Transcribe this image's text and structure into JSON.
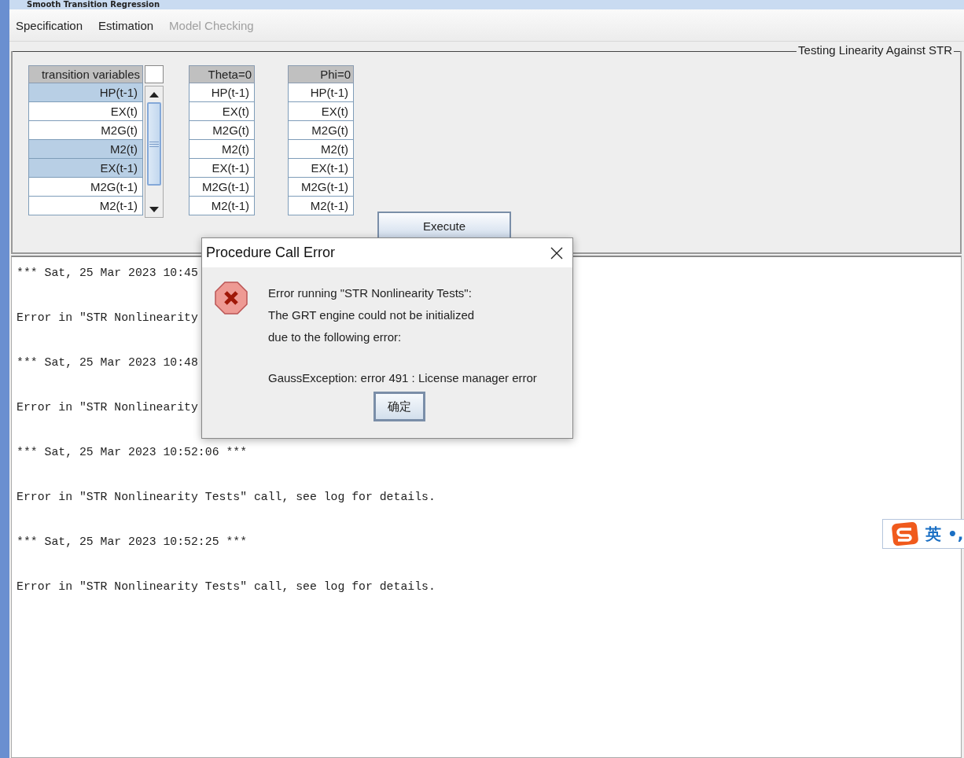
{
  "window": {
    "title": "Smooth Transition Regression"
  },
  "menu": [
    {
      "label": "Specification",
      "disabled": false
    },
    {
      "label": "Estimation",
      "disabled": false
    },
    {
      "label": "Model Checking",
      "disabled": true
    }
  ],
  "panel": {
    "title": "Testing Linearity Against STR",
    "transition_table": {
      "header": "transition variables",
      "rows": [
        {
          "label": "HP(t-1)",
          "selected": true
        },
        {
          "label": "EX(t)",
          "selected": false
        },
        {
          "label": "M2G(t)",
          "selected": false
        },
        {
          "label": "M2(t)",
          "selected": true
        },
        {
          "label": "EX(t-1)",
          "selected": true
        },
        {
          "label": "M2G(t-1)",
          "selected": false
        },
        {
          "label": "M2(t-1)",
          "selected": false
        }
      ]
    },
    "tables": [
      {
        "header": "Theta=0",
        "rows": [
          "HP(t-1)",
          "EX(t)",
          "M2G(t)",
          "M2(t)",
          "EX(t-1)",
          "M2G(t-1)",
          "M2(t-1)"
        ]
      },
      {
        "header": "Phi=0",
        "rows": [
          "HP(t-1)",
          "EX(t)",
          "M2G(t)",
          "M2(t)",
          "EX(t-1)",
          "M2G(t-1)",
          "M2(t-1)"
        ]
      }
    ],
    "execute_button": "Execute"
  },
  "log": [
    "*** Sat, 25 Mar 2023 10:45",
    "Error in \"STR Nonlinearity",
    "*** Sat, 25 Mar 2023 10:48",
    "Error in \"STR Nonlinearity",
    "*** Sat, 25 Mar 2023 10:52:06 ***",
    "Error in \"STR Nonlinearity Tests\" call, see log for details.",
    "*** Sat, 25 Mar 2023 10:52:25 ***",
    "Error in \"STR Nonlinearity Tests\" call, see log for details."
  ],
  "dialog": {
    "title": "Procedure Call Error",
    "lines": [
      "Error running \"STR Nonlinearity Tests\":",
      "The GRT engine could not be initialized",
      "due to the following error:"
    ],
    "detail": "GaussException: error 491 : License manager error",
    "ok_button": "确定"
  },
  "ime": {
    "mode": "英",
    "punct": "•,"
  }
}
